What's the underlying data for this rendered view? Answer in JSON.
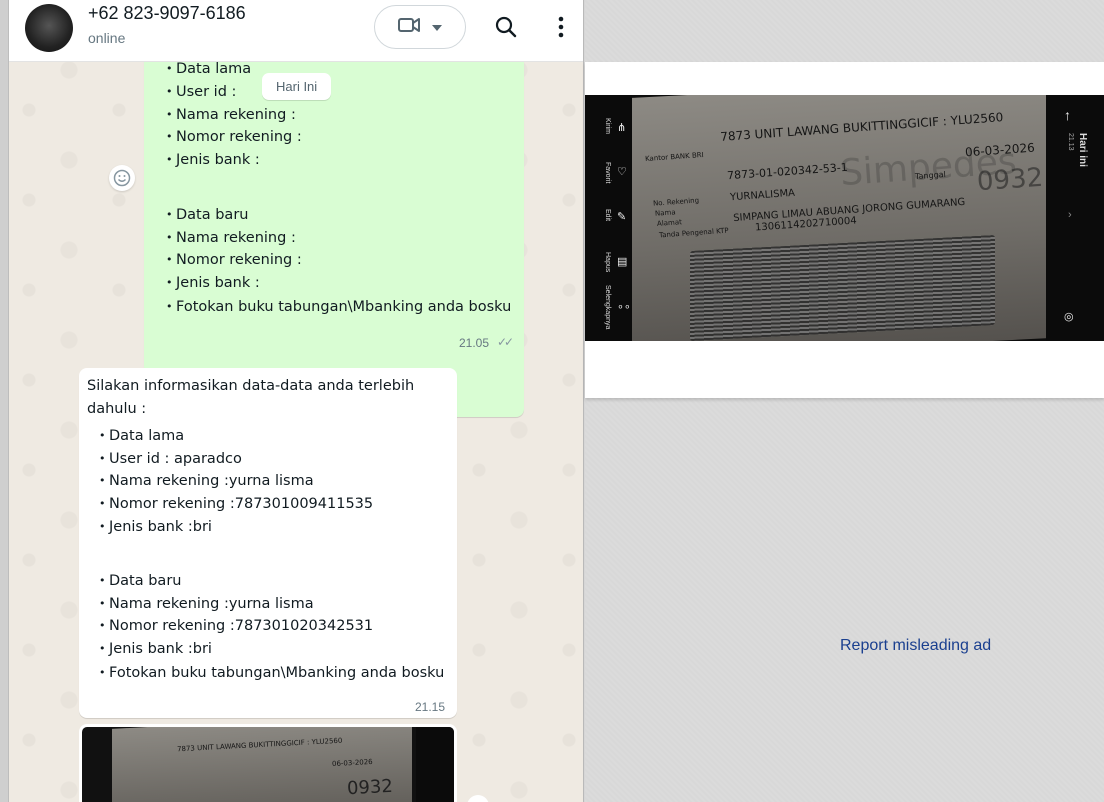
{
  "header": {
    "contact_name": "+62 823-9097-6186",
    "status": "online"
  },
  "chat": {
    "date_chip": "Hari Ini",
    "outgoing": {
      "lines": [
        "Data lama",
        "User id :",
        "Nama rekening :",
        "Nomor rekening :",
        "Jenis bank :",
        "Data baru",
        "Nama rekening :",
        "Nomor rekening :",
        "Jenis bank :",
        "Fotokan buku tabungan\\Mbanking anda bosku"
      ],
      "time": "21.05",
      "ticks": "✓✓"
    },
    "incoming": {
      "intro_1": "Silakan informasikan data-data anda terlebih",
      "intro_2": "dahulu :",
      "lines": [
        "Data lama",
        "User id : aparadco",
        "Nama rekening :yurna lisma",
        "Nomor rekening :787301009411535",
        "Jenis bank :bri",
        "Data baru",
        "Nama rekening :yurna lisma",
        "Nomor rekening :787301020342531",
        "Jenis bank :bri",
        "Fotokan buku tabungan\\Mbanking anda bosku"
      ],
      "time": "21.15"
    }
  },
  "ad": {
    "photo": {
      "header": "7873 UNIT LAWANG BUKITTINGGICIF : YLU2560",
      "office_label": "Kantor BANK BRI",
      "account_number": "7873-01-020342-53-1",
      "date": "06-03-2026",
      "date_label": "Tanggal",
      "name": "YURNALISMA",
      "address": "SIMPANG LIMAU ABUANG JORONG GUMARANG",
      "ktp": "1306114202710004",
      "label_no_rek": "No. Rekening",
      "label_nama": "Nama",
      "label_alamat": "Alamat",
      "label_ktp": "Tanda Pengenal KTP",
      "watermark": "Simpedes",
      "big_number": "0932",
      "left_menu": [
        "Kirim",
        "Favorit",
        "Edit",
        "Hapus",
        "Selengkapnya"
      ],
      "right_title": "Hari ini",
      "right_time": "21.13"
    },
    "report_link": "Report misleading ad"
  }
}
